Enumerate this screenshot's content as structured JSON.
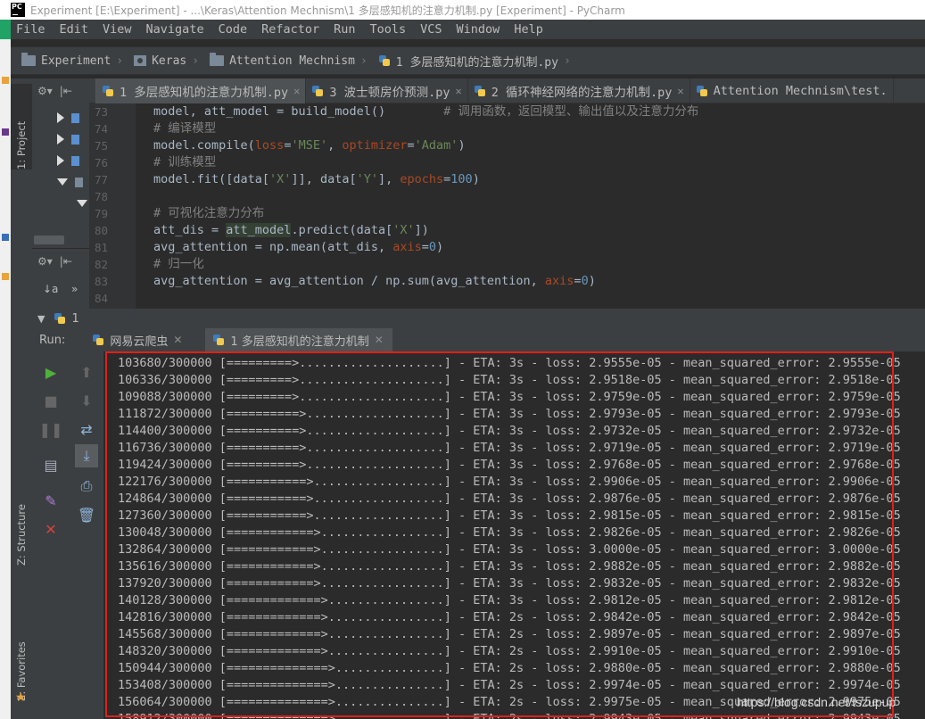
{
  "window": {
    "title": "Experiment [E:\\Experiment] - ...\\Keras\\Attention Mechnism\\1 多层感知机的注意力机制.py [Experiment] - PyCharm",
    "logo": "PC"
  },
  "menu": [
    "File",
    "Edit",
    "View",
    "Navigate",
    "Code",
    "Refactor",
    "Run",
    "Tools",
    "VCS",
    "Window",
    "Help"
  ],
  "breadcrumb": [
    {
      "label": "Experiment",
      "icon": "folder-icon"
    },
    {
      "label": "Keras",
      "icon": "package-icon"
    },
    {
      "label": "Attention Mechnism",
      "icon": "folder-icon"
    },
    {
      "label": "1 多层感知机的注意力机制.py",
      "icon": "python-file-icon"
    }
  ],
  "sidebar": {
    "project_tab": "1: Project",
    "structure_tab": "Z: Structure",
    "favorites_tab": "2: Favorites"
  },
  "editor": {
    "tabs": [
      {
        "label": "1 多层感知机的注意力机制.py",
        "active": true,
        "closable": true
      },
      {
        "label": "3 波士顿房价预测.py",
        "active": false,
        "closable": true
      },
      {
        "label": "2 循环神经网络的注意力机制.py",
        "active": false,
        "closable": true
      },
      {
        "label": "Attention Mechnism\\test.",
        "active": false,
        "closable": false
      }
    ],
    "line_numbers": [
      "73",
      "74",
      "75",
      "76",
      "77",
      "78",
      "79",
      "80",
      "81",
      "82",
      "83",
      "84"
    ],
    "lines": [
      "model, att_model = build_model()        # 调用函数，返回模型、输出值以及注意力分布",
      "# 编译模型",
      "model.compile(loss='MSE', optimizer='Adam')",
      "# 训练模型",
      "model.fit([data['X']], data['Y'], epochs=100)",
      "",
      "# 可视化注意力分布",
      "att_dis = att_model.predict(data['X'])",
      "avg_attention = np.mean(att_dis, axis=0)",
      "# 归一化",
      "avg_attention = avg_attention / np.sum(avg_attention, axis=0)",
      ""
    ]
  },
  "run": {
    "label": "Run:",
    "collapsed_tab": "1",
    "tabs": [
      {
        "label": "网易云爬虫",
        "active": false
      },
      {
        "label": "1 多层感知机的注意力机制",
        "active": true
      }
    ],
    "console_lines": [
      "103680/300000 [=========>....................] - ETA: 3s - loss: 2.9555e-05 - mean_squared_error: 2.9555e-05",
      "106336/300000 [=========>....................] - ETA: 3s - loss: 2.9518e-05 - mean_squared_error: 2.9518e-05",
      "109088/300000 [=========>....................] - ETA: 3s - loss: 2.9759e-05 - mean_squared_error: 2.9759e-05",
      "111872/300000 [==========>...................] - ETA: 3s - loss: 2.9793e-05 - mean_squared_error: 2.9793e-05",
      "114400/300000 [==========>...................] - ETA: 3s - loss: 2.9732e-05 - mean_squared_error: 2.9732e-05",
      "116736/300000 [==========>...................] - ETA: 3s - loss: 2.9719e-05 - mean_squared_error: 2.9719e-05",
      "119424/300000 [==========>...................] - ETA: 3s - loss: 2.9768e-05 - mean_squared_error: 2.9768e-05",
      "122176/300000 [===========>..................] - ETA: 3s - loss: 2.9906e-05 - mean_squared_error: 2.9906e-05",
      "124864/300000 [===========>..................] - ETA: 3s - loss: 2.9876e-05 - mean_squared_error: 2.9876e-05",
      "127360/300000 [===========>..................] - ETA: 3s - loss: 2.9815e-05 - mean_squared_error: 2.9815e-05",
      "130048/300000 [============>.................] - ETA: 3s - loss: 2.9826e-05 - mean_squared_error: 2.9826e-05",
      "132864/300000 [============>.................] - ETA: 3s - loss: 3.0000e-05 - mean_squared_error: 3.0000e-05",
      "135616/300000 [============>.................] - ETA: 3s - loss: 2.9882e-05 - mean_squared_error: 2.9882e-05",
      "137920/300000 [============>.................] - ETA: 3s - loss: 2.9832e-05 - mean_squared_error: 2.9832e-05",
      "140128/300000 [=============>................] - ETA: 3s - loss: 2.9812e-05 - mean_squared_error: 2.9812e-05",
      "142816/300000 [=============>................] - ETA: 2s - loss: 2.9842e-05 - mean_squared_error: 2.9842e-05",
      "145568/300000 [=============>................] - ETA: 2s - loss: 2.9897e-05 - mean_squared_error: 2.9897e-05",
      "148320/300000 [=============>................] - ETA: 2s - loss: 2.9910e-05 - mean_squared_error: 2.9910e-05",
      "150944/300000 [==============>...............] - ETA: 2s - loss: 2.9880e-05 - mean_squared_error: 2.9880e-05",
      "153408/300000 [==============>...............] - ETA: 2s - loss: 2.9974e-05 - mean_squared_error: 2.9974e-05",
      "156064/300000 [==============>...............] - ETA: 2s - loss: 2.9975e-05 - mean_squared_error: 2.9975e-05",
      "158912/300000 [==============>...............] - ETA: 2s - loss: 2.9943e-05 - mean_squared_error: 2.9943e-05"
    ]
  },
  "colors": {
    "highlight_box": "#e0201c",
    "run_green": "#4fb13a",
    "stop_red": "#d9413a"
  },
  "watermark": "https://blog.csdn.net/tszupup"
}
